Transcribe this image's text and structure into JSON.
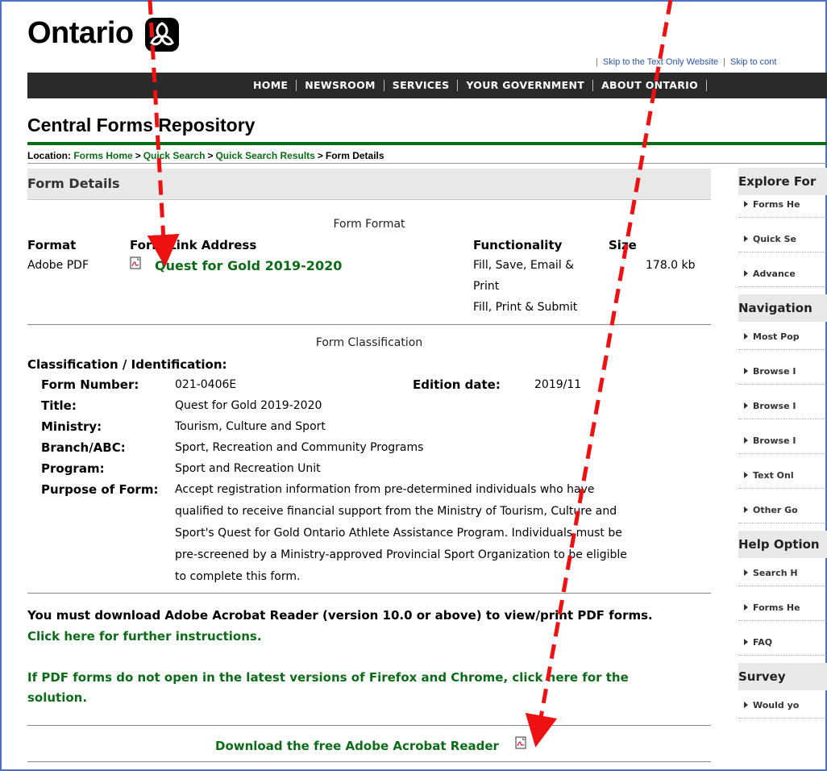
{
  "header": {
    "logo_text": "Ontario",
    "skip_links": [
      "Skip to the Text Only Website",
      "Skip to cont"
    ],
    "nav": [
      "HOME",
      "NEWSROOM",
      "SERVICES",
      "YOUR GOVERNMENT",
      "ABOUT ONTARIO"
    ],
    "site_title": "Central Forms Repository"
  },
  "breadcrumb": {
    "prefix": "Location:",
    "items": [
      "Forms Home",
      "Quick Search",
      "Quick Search Results"
    ],
    "current": "Form Details",
    "separator": ">"
  },
  "form_details": {
    "heading": "Form Details",
    "format_caption": "Form Format",
    "columns": [
      "Format",
      "Form Link Address",
      "Functionality",
      "Size"
    ],
    "row": {
      "format": "Adobe PDF",
      "link": "Quest for Gold 2019-2020",
      "functionality_1": "Fill, Save, Email &",
      "functionality_2": "Print",
      "functionality_3": "Fill, Print & Submit",
      "size": "178.0 kb"
    },
    "classification_caption": "Form Classification",
    "classification_heading": "Classification / Identification:",
    "fields": {
      "form_number_label": "Form Number:",
      "form_number": "021-0406E",
      "edition_label": "Edition date:",
      "edition": "2019/11",
      "title_label": "Title:",
      "title": "Quest for Gold 2019-2020",
      "ministry_label": "Ministry:",
      "ministry": "Tourism, Culture and Sport",
      "branch_label": "Branch/ABC:",
      "branch": "Sport, Recreation and Community Programs",
      "program_label": "Program:",
      "program": "Sport and Recreation Unit",
      "purpose_label": "Purpose of Form:",
      "purpose_lines": [
        "Accept registration information from pre-determined individuals who have",
        "qualified to receive financial support from the Ministry of Tourism, Culture and",
        "Sport's Quest for Gold Ontario Athlete Assistance Program. Individuals must be",
        "pre-screened by a Ministry-approved Provincial Sport Organization to be eligible",
        "to complete this form."
      ]
    },
    "notice": "You must download Adobe Acrobat Reader (version 10.0 or above) to view/print PDF forms.",
    "instructions_link": "Click here for further instructions.",
    "firefox_line_1": "If PDF forms do not open in the latest versions of Firefox and Chrome, click here for the",
    "firefox_line_2": "solution.",
    "download_link": "Download the free Adobe Acrobat Reader"
  },
  "sidebar": {
    "sections": [
      {
        "title": "Explore For",
        "items": [
          "Forms He",
          "Quick Se",
          "Advance"
        ]
      },
      {
        "title": "Navigation",
        "items": [
          "Most Pop",
          "Browse I",
          "Browse I",
          "Browse I",
          "Text Onl",
          "Other Go"
        ]
      },
      {
        "title": "Help Option",
        "items": [
          "Search H",
          "Forms He",
          "FAQ"
        ]
      },
      {
        "title": "Survey",
        "items": [
          "Would yo"
        ]
      }
    ]
  },
  "colors": {
    "link_green": "#0b6b18",
    "nav_bg": "#2b2b2b",
    "arrow_red": "#ee1111",
    "frame_blue": "#4b72c4"
  },
  "icons": [
    "trillium-logo-icon",
    "pdf-icon",
    "triangle-bullet-icon"
  ]
}
